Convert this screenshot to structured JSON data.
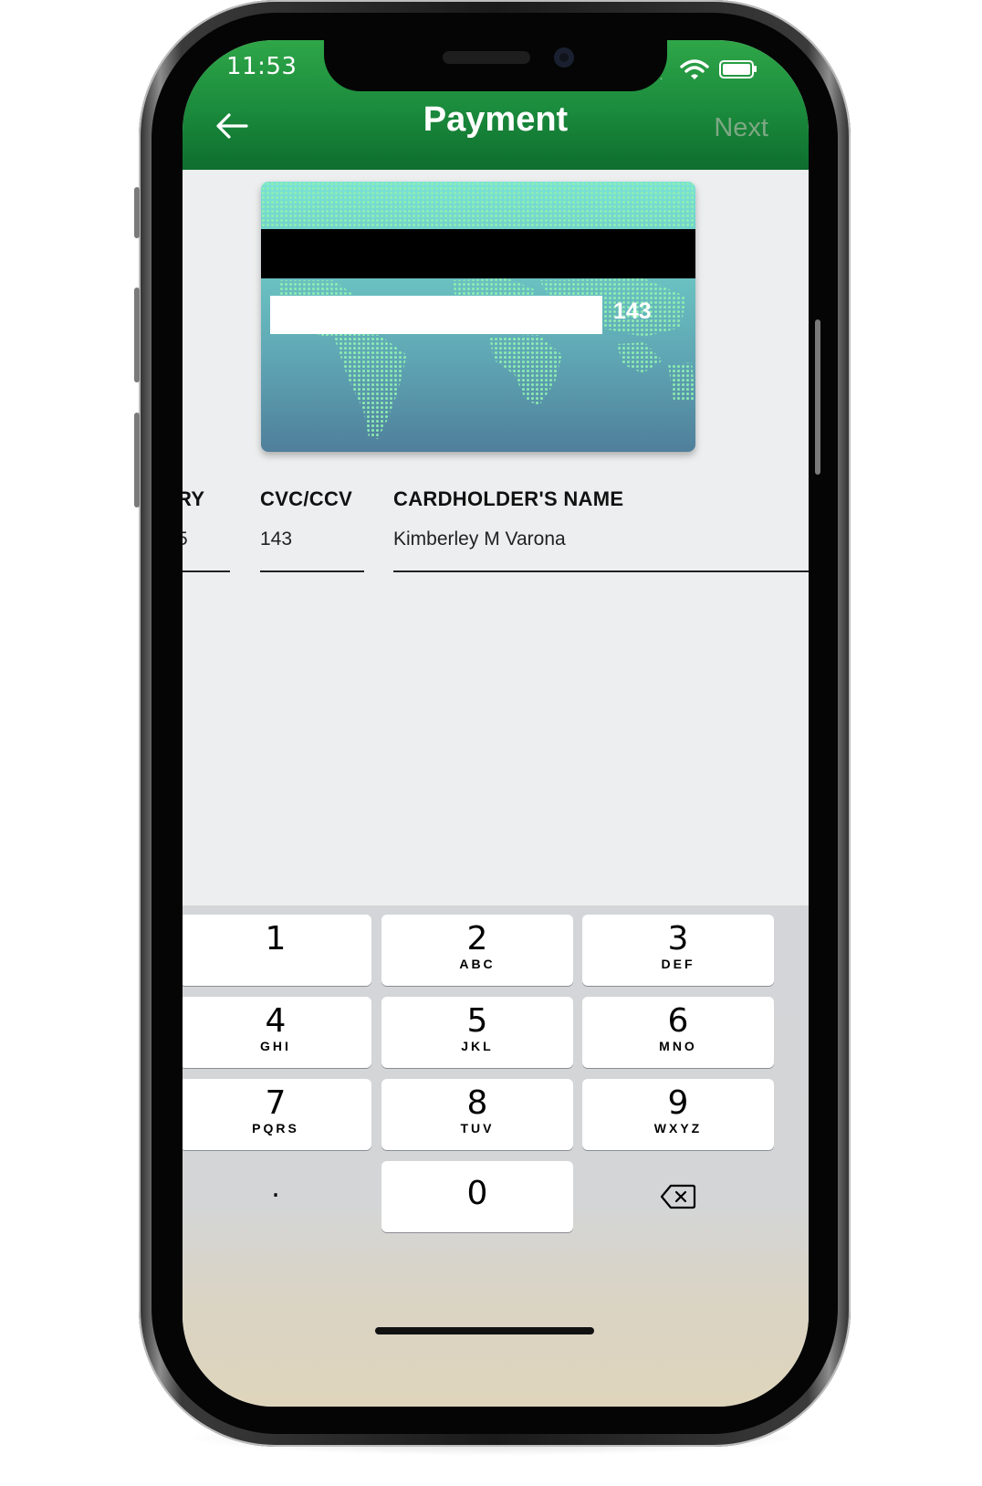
{
  "status_bar": {
    "time": "11:53",
    "signal": "...."
  },
  "nav": {
    "title": "Payment",
    "next_label": "Next"
  },
  "card": {
    "cvc": "143"
  },
  "fields": {
    "expiry": {
      "label": "RY",
      "value": "5"
    },
    "cvc": {
      "label": "CVC/CCV",
      "value": "143"
    },
    "name": {
      "label": "CARDHOLDER'S NAME",
      "value": "Kimberley M Varona"
    }
  },
  "keypad": {
    "keys": [
      {
        "digit": "1",
        "letters": ""
      },
      {
        "digit": "2",
        "letters": "ABC"
      },
      {
        "digit": "3",
        "letters": "DEF"
      },
      {
        "digit": "4",
        "letters": "GHI"
      },
      {
        "digit": "5",
        "letters": "JKL"
      },
      {
        "digit": "6",
        "letters": "MNO"
      },
      {
        "digit": "7",
        "letters": "PQRS"
      },
      {
        "digit": "8",
        "letters": "TUV"
      },
      {
        "digit": "9",
        "letters": "WXYZ"
      }
    ],
    "decimal": ".",
    "zero": "0"
  },
  "colors": {
    "nav_green": "#1a8a3c",
    "next_disabled": "#7ea884",
    "card_top": "#7ae2d6",
    "card_bottom": "#4f7f9b",
    "screen_bg": "#eceeef"
  },
  "icons": [
    "back-arrow-icon",
    "wifi-icon",
    "battery-icon",
    "backspace-icon"
  ]
}
